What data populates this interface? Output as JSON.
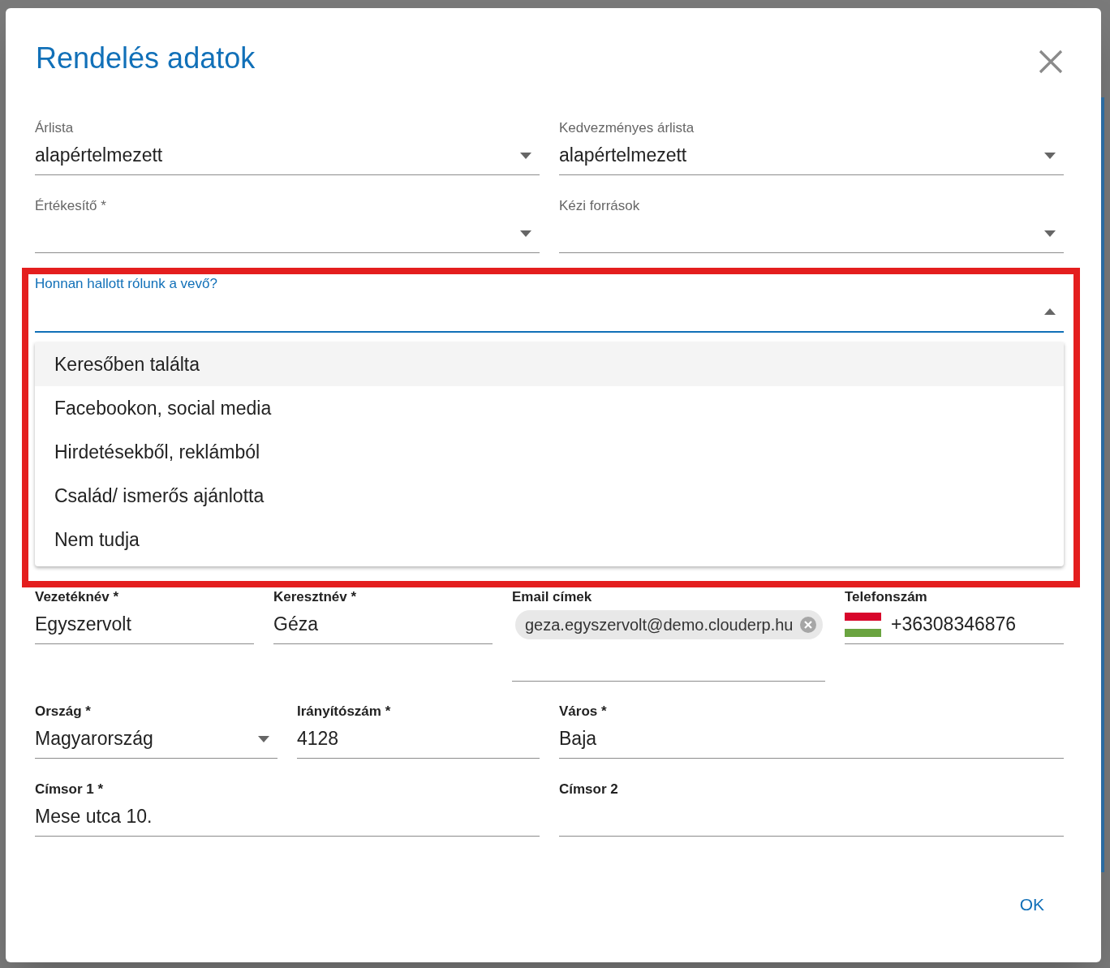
{
  "dialog": {
    "title": "Rendelés adatok"
  },
  "top_rows": [
    {
      "fields": [
        {
          "kind": "select",
          "label": "Árlista",
          "value": "alapértelmezett"
        },
        {
          "kind": "select",
          "label": "Kedvezményes árlista",
          "value": "alapértelmezett"
        }
      ]
    },
    {
      "fields": [
        {
          "kind": "select",
          "label": "Értékesítő *"
        },
        {
          "kind": "select",
          "label": "Kézi források"
        }
      ]
    }
  ],
  "source_field": {
    "label": "Honnan hallott rólunk a vevő?",
    "expanded": true,
    "options": [
      {
        "label": "Keresőben találta",
        "highlighted": true
      },
      {
        "label": "Facebookon, social media",
        "highlighted": false
      },
      {
        "label": "Hirdetésekből, reklámból",
        "highlighted": false
      },
      {
        "label": "Család/ ismerős ajánlotta",
        "highlighted": false
      },
      {
        "label": "Nem tudja",
        "highlighted": false
      }
    ]
  },
  "customer_rows": [
    {
      "fields": [
        {
          "kind": "text",
          "label": "Vezetéknév *",
          "value": "Egyszervolt"
        },
        {
          "kind": "text",
          "label": "Keresztnév *",
          "value": "Géza"
        },
        {
          "kind": "chips",
          "label": "Email címek",
          "chips": [
            "geza.egyszervolt@demo.clouderp.hu"
          ]
        },
        {
          "kind": "phone",
          "label": "Telefonszám",
          "value": "+36308346876"
        }
      ]
    },
    {
      "fields": [
        {
          "kind": "select",
          "label": "Ország *",
          "value": "Magyarország"
        },
        {
          "kind": "text",
          "label": "Irányítószám *",
          "value": "4128"
        },
        {
          "kind": "text",
          "label": "Város *",
          "value": "Baja"
        }
      ]
    },
    {
      "fields": [
        {
          "kind": "text",
          "label": "Címsor 1 *",
          "value": "Mese utca 10."
        },
        {
          "kind": "text",
          "label": "Címsor 2"
        }
      ]
    }
  ],
  "actions": [
    "OK"
  ]
}
